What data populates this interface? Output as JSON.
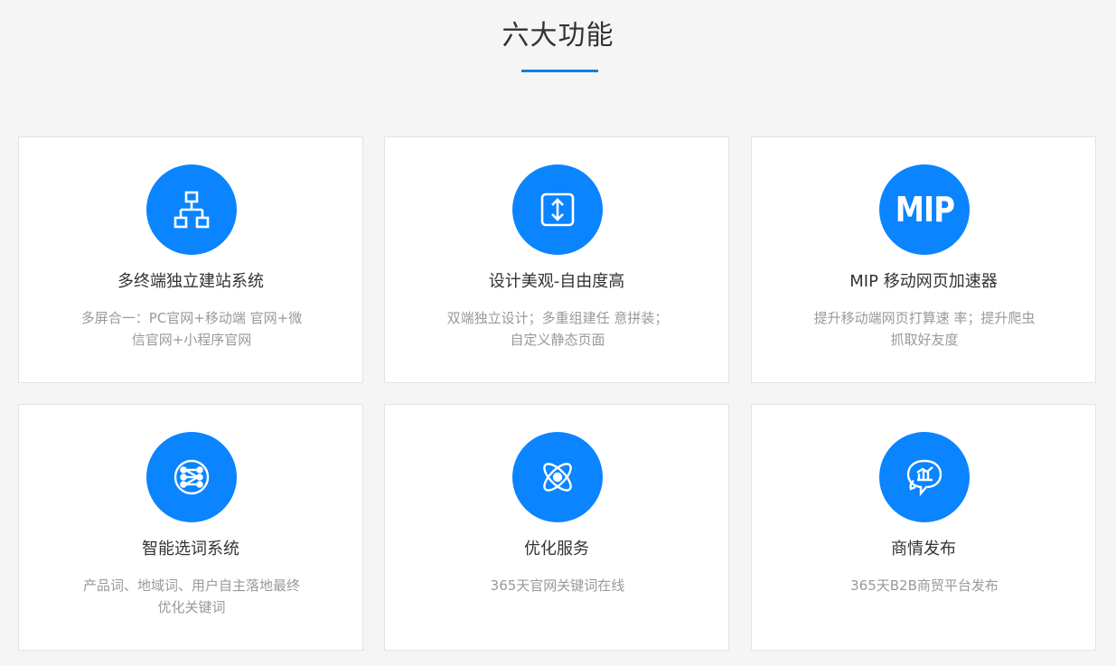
{
  "section": {
    "title": "六大功能"
  },
  "colors": {
    "accent": "#0a84ff",
    "underline": "#0a7fe8",
    "background": "#f5f5f5",
    "card": "#ffffff",
    "title_text": "#333333",
    "desc_text": "#999999"
  },
  "features": [
    {
      "icon": "sitemap-icon",
      "title": "多终端独立建站系统",
      "desc": "多屏合一：PC官网+移动端 官网+微信官网+小程序官网"
    },
    {
      "icon": "vertical-resize-icon",
      "title": "设计美观-自由度高",
      "desc": "双端独立设计；多重组建任 意拼装；自定义静态页面"
    },
    {
      "icon": "mip-logo-icon",
      "icon_text": "MIP",
      "title": "MIP 移动网页加速器",
      "desc": "提升移动端网页打算速 率；提升爬虫抓取好友度"
    },
    {
      "icon": "network-nodes-icon",
      "title": "智能选词系统",
      "desc": "产品词、地域词、用户自主落地最终优化关键词"
    },
    {
      "icon": "atom-icon",
      "title": "优化服务",
      "desc": "365天官网关键词在线"
    },
    {
      "icon": "chat-chart-icon",
      "title": "商情发布",
      "desc": "365天B2B商贸平台发布"
    }
  ]
}
